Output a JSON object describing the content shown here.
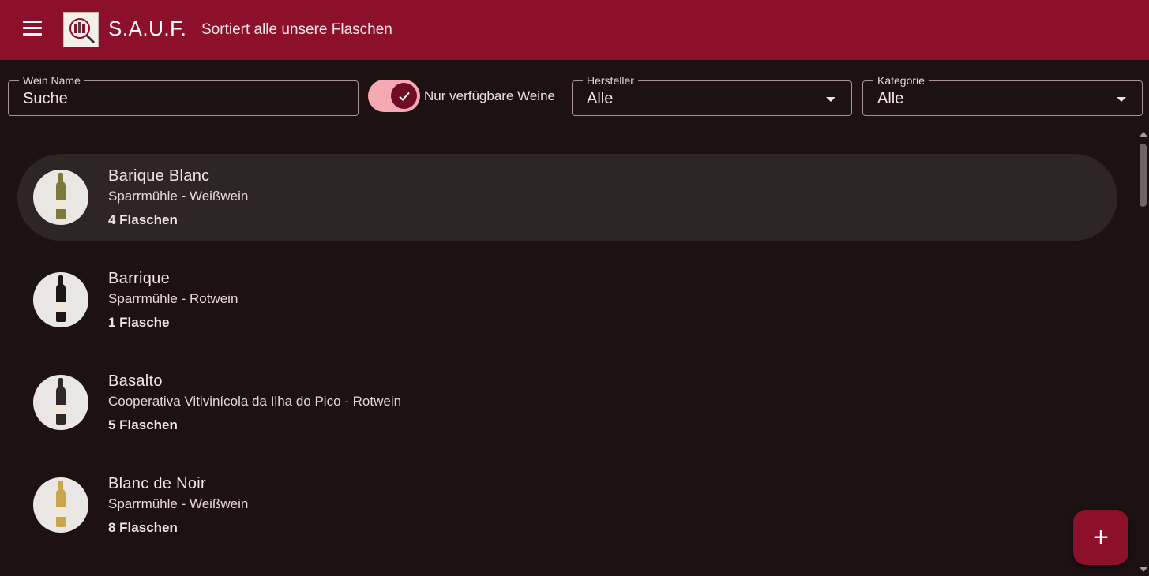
{
  "header": {
    "title": "S.A.U.F.",
    "subtitle": "Sortiert alle unsere Flaschen"
  },
  "filters": {
    "name_label": "Wein Name",
    "name_value": "Suche",
    "available_only_label": "Nur verfügbare Weine",
    "available_only_checked": true,
    "manufacturer_label": "Hersteller",
    "manufacturer_value": "Alle",
    "category_label": "Kategorie",
    "category_value": "Alle"
  },
  "wines": [
    {
      "name": "Barique Blanc",
      "subtitle": "Sparrmühle - Weißwein",
      "count": "4 Flaschen",
      "bottle_color": "#7a7a3a"
    },
    {
      "name": "Barrique",
      "subtitle": "Sparrmühle - Rotwein",
      "count": "1 Flasche",
      "bottle_color": "#1c1616"
    },
    {
      "name": "Basalto",
      "subtitle": "Cooperativa Vitivinícola da Ilha do Pico - Rotwein",
      "count": "5 Flaschen",
      "bottle_color": "#2e2828"
    },
    {
      "name": "Blanc de Noir",
      "subtitle": "Sparrmühle - Weißwein",
      "count": "8 Flaschen",
      "bottle_color": "#c9a64a"
    }
  ],
  "fab": {
    "icon": "plus-icon",
    "symbol": "+"
  },
  "colors": {
    "primary": "#8d102a",
    "background": "#1c1213",
    "toggle_track": "#f7a9b3"
  }
}
